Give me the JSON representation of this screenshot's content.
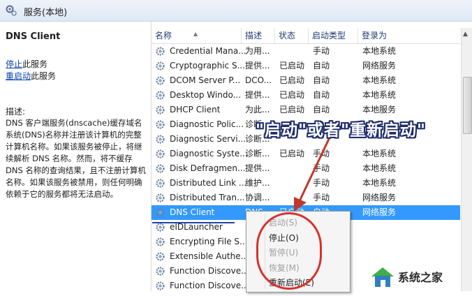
{
  "window": {
    "title": "服务(本地)",
    "icon": "services-icon"
  },
  "left_pane": {
    "service_name": "DNS Client",
    "stop_link": "停止",
    "stop_suffix": "此服务",
    "restart_link": "重启动",
    "restart_suffix": "此服务",
    "desc_label": "描述:",
    "description": "DNS 客户端服务(dnscache)缓存域名系统(DNS)名称并注册该计算机的完整计算机名称。如果该服务被停止，将继续解析 DNS 名称。然而，将不缓存 DNS 名称的查询结果，且不注册计算机名称。如果该服务被禁用，则任何明确依赖于它的服务都将无法启动。"
  },
  "columns": [
    "名称",
    "描述",
    "状态",
    "启动类型",
    "登录为"
  ],
  "services": [
    {
      "name": "Credential Mana...",
      "desc": "为用...",
      "status": "",
      "startup": "手动",
      "logon": "本地系统"
    },
    {
      "name": "Cryptographic S...",
      "desc": "提供...",
      "status": "已启动",
      "startup": "自动",
      "logon": "网络服务"
    },
    {
      "name": "DCOM Server P...",
      "desc": "DCO...",
      "status": "已启动",
      "startup": "自动",
      "logon": "本地系统"
    },
    {
      "name": "Desktop Windo...",
      "desc": "提供...",
      "status": "已启动",
      "startup": "自动",
      "logon": "本地系统"
    },
    {
      "name": "DHCP Client",
      "desc": "为此...",
      "status": "已启动",
      "startup": "自动",
      "logon": "本地服务"
    },
    {
      "name": "Diagnostic Polic...",
      "desc": "诊断...",
      "status": "",
      "startup": "",
      "logon": ""
    },
    {
      "name": "Diagnostic Servi...",
      "desc": "诊断...",
      "status": "",
      "startup": "",
      "logon": ""
    },
    {
      "name": "Diagnostic Syste...",
      "desc": "诊断...",
      "status": "已启动",
      "startup": "手动",
      "logon": "本地系统"
    },
    {
      "name": "Disk Defragmen...",
      "desc": "提供...",
      "status": "",
      "startup": "手动",
      "logon": "本地系统"
    },
    {
      "name": "Distributed Link ...",
      "desc": "维护...",
      "status": "",
      "startup": "手动",
      "logon": "本地系统"
    },
    {
      "name": "Distributed Tran...",
      "desc": "协调...",
      "status": "",
      "startup": "手动",
      "logon": "网络服务"
    },
    {
      "name": "DNS Client",
      "desc": "DNS...",
      "status": "已启动",
      "startup": "自动",
      "logon": "网络服务",
      "selected": true
    },
    {
      "name": "eIDLauncher",
      "desc": "",
      "status": "",
      "startup": "",
      "logon": ""
    },
    {
      "name": "Encrypting File S...",
      "desc": "",
      "status": "",
      "startup": "",
      "logon": ""
    },
    {
      "name": "Extensible Authe...",
      "desc": "",
      "status": "",
      "startup": "",
      "logon": ""
    },
    {
      "name": "Function Discove...",
      "desc": "",
      "status": "",
      "startup": "",
      "logon": ""
    },
    {
      "name": "Function Discove...",
      "desc": "",
      "status": "",
      "startup": "",
      "logon": ""
    }
  ],
  "context_menu": [
    {
      "label": "启动(S)",
      "disabled": true
    },
    {
      "label": "停止(O)",
      "disabled": false
    },
    {
      "label": "暂停(U)",
      "disabled": true
    },
    {
      "label": "恢复(M)",
      "disabled": true
    },
    {
      "label": "重新启动(E)",
      "disabled": false
    }
  ],
  "annotation": "\"启动\"或者\"重新启动\"",
  "watermark": {
    "text": "系统之家"
  },
  "colors": {
    "selection": "#3399ff",
    "annotation_red": "#d9302b",
    "annotation_outline": "#1e2d6b"
  }
}
